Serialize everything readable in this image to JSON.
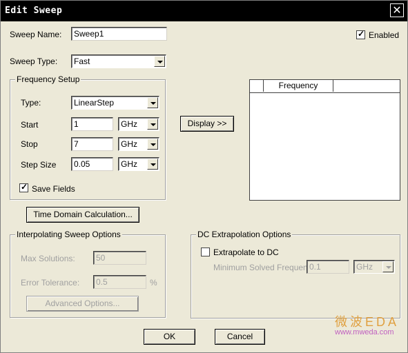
{
  "window": {
    "title": "Edit Sweep",
    "close_glyph": "✕"
  },
  "sweep": {
    "name_label": "Sweep Name:",
    "name_value": "Sweep1",
    "type_label": "Sweep Type:",
    "type_value": "Fast",
    "enabled_label": "Enabled",
    "enabled_checked": true
  },
  "frequency_setup": {
    "title": "Frequency Setup",
    "type_label": "Type:",
    "type_value": "LinearStep",
    "start_label": "Start",
    "start_value": "1",
    "start_unit": "GHz",
    "stop_label": "Stop",
    "stop_value": "7",
    "stop_unit": "GHz",
    "step_label": "Step Size",
    "step_value": "0.05",
    "step_unit": "GHz",
    "save_fields_label": "Save Fields",
    "save_fields_checked": true
  },
  "display_button": "Display >>",
  "freq_list": {
    "column_header": "Frequency",
    "rows": []
  },
  "time_domain_button": "Time Domain Calculation...",
  "interpolating": {
    "title": "Interpolating Sweep Options",
    "max_solutions_label": "Max Solutions:",
    "max_solutions_value": "50",
    "error_tolerance_label": "Error Tolerance:",
    "error_tolerance_value": "0.5",
    "error_tolerance_unit": "%",
    "advanced_button": "Advanced Options..."
  },
  "dc_extrapolation": {
    "title": "DC Extrapolation Options",
    "extrapolate_label": "Extrapolate to DC",
    "extrapolate_checked": false,
    "min_freq_label": "Minimum Solved Frequency",
    "min_freq_value": "0.1",
    "min_freq_unit": "GHz"
  },
  "footer": {
    "ok": "OK",
    "cancel": "Cancel"
  },
  "watermark": {
    "cn": "微波EDA",
    "url": "www.mweda.com"
  },
  "colors": {
    "titlebar": "#000000",
    "dialog_bg": "#ece9d8",
    "watermark_cn": "#e0a040",
    "watermark_url": "#c060c0"
  }
}
